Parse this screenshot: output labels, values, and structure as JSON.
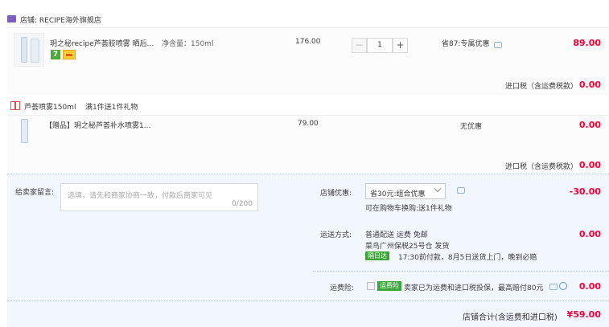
{
  "shop": {
    "label": "店铺: RECIPE海外旗舰店",
    "icon": "shop-icon",
    "accent": "#7a5dc7"
  },
  "item": {
    "name": "玥之秘recipe芦荟胶喷雾 晒后...",
    "spec": "净含量：150ml",
    "unit_price": "176.00",
    "quantity": "1",
    "minus_label": "−",
    "plus_label": "+",
    "discount": "省87:专属优惠",
    "subtotal": "89.00",
    "badge_7day": "7",
    "tax_label": "进口税（含运费税款）",
    "tax_value": "0.00"
  },
  "gift_group": {
    "title": "芦荟喷雾150ml",
    "rule": "满1件送1件礼物",
    "icon": "gift-icon"
  },
  "gift": {
    "name": "【赠品】玥之秘芦荟补水喷雾1...",
    "unit_price": "79.00",
    "discount": "无优惠",
    "subtotal": "0.00",
    "tax_label": "进口税（含运费税款）",
    "tax_value": "0.00"
  },
  "message": {
    "label": "给卖家留言:",
    "placeholder": "选填，请先和商家协商一致，付款后商家可见",
    "count": "0/200"
  },
  "coupon": {
    "label": "店铺优惠:",
    "selected": "省30元:组合优惠",
    "note": "可在购物车换购:送1件礼物",
    "value": "-30.00"
  },
  "shipping": {
    "label": "运送方式:",
    "method": "普通配送 运费 免邮",
    "warehouse": "菜鸟广州保税25号仓  发货",
    "badge": "隔日达",
    "promise": "17:30前付款，8月5日送货上门，晚到必赔",
    "value": "0.00"
  },
  "insurance": {
    "label": "运费险:",
    "badge": "运费险",
    "text": "卖家已为运费和进口税投保，最高赔付80元",
    "value": "0.00"
  },
  "total": {
    "label": "店铺合计(含运费和进口税)",
    "value": "¥59.00"
  }
}
